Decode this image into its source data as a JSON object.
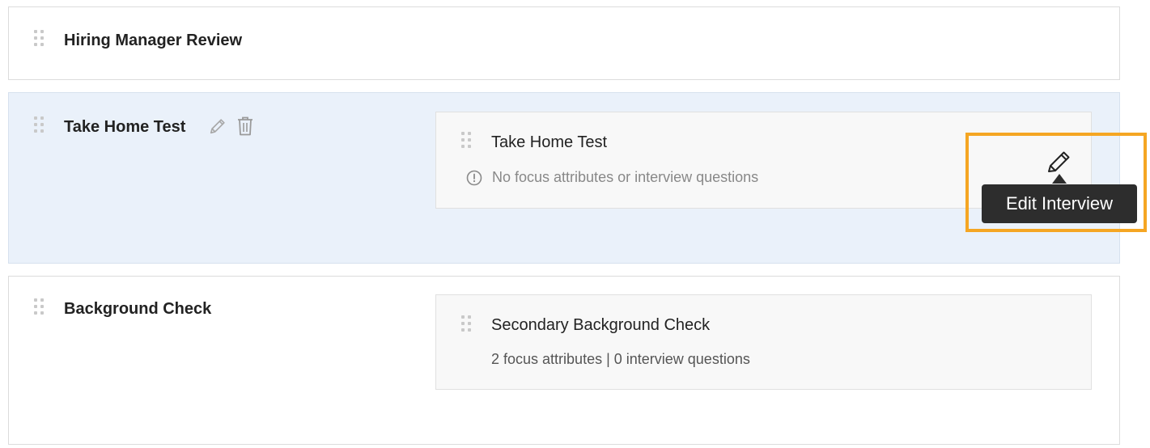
{
  "stages": [
    {
      "name": "Hiring Manager Review",
      "active": false,
      "interviews": []
    },
    {
      "name": "Take Home Test",
      "active": true,
      "tools": [
        "pencil-icon",
        "trash-icon"
      ],
      "interviews": [
        {
          "title": "Take Home Test",
          "meta": "No focus attributes or interview questions",
          "meta_icon": "info-circle-icon"
        }
      ]
    },
    {
      "name": "Background Check",
      "active": false,
      "interviews": [
        {
          "title": "Secondary Background Check",
          "meta": "2 focus attributes | 0 interview questions"
        }
      ]
    }
  ],
  "tooltip": {
    "label": "Edit Interview",
    "icon": "pencil-icon"
  },
  "colors": {
    "active_stage_bg": "#eaf1fa",
    "highlight": "#f5a623",
    "tooltip_bg": "#2d2d2d"
  }
}
